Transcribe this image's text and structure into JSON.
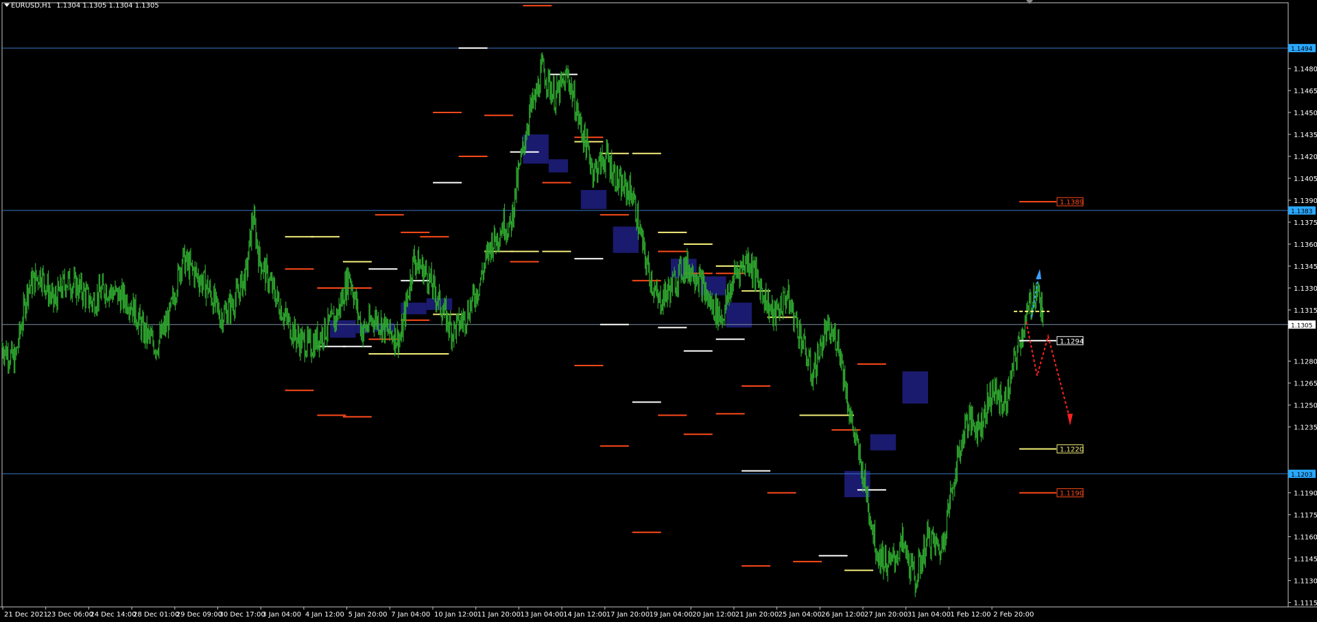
{
  "window": {
    "symbol_label": "EURUSD,H1",
    "ohlc": "1.1304 1.1305 1.1304 1.1305"
  },
  "colors": {
    "background": "#000000",
    "candles": "#2fa82f",
    "grid_line_blue": "#3c78c8",
    "current_price_line": "#7f8fa6",
    "zone_fill": "#1a1a6e",
    "level_red": "#ff4a1a",
    "level_white": "#ffffff",
    "level_yellow": "#f5f07a",
    "arrow_red": "#ff2020",
    "arrow_blue": "#3ca0ff",
    "axis_text": "#ffffff"
  },
  "chart_data": {
    "type": "candlestick",
    "symbol": "EURUSD",
    "timeframe": "H1",
    "y_range": [
      1.1112,
      1.1525
    ],
    "y_ticks": [
      "1.1480",
      "1.1465",
      "1.1450",
      "1.1435",
      "1.1420",
      "1.1405",
      "1.1390",
      "1.1375",
      "1.1360",
      "1.1345",
      "1.1330",
      "1.1315",
      "1.1280",
      "1.1265",
      "1.1250",
      "1.1235",
      "1.1190",
      "1.1175",
      "1.1160",
      "1.1145",
      "1.1130",
      "1.1115"
    ],
    "y_tick_values": [
      1.148,
      1.1465,
      1.145,
      1.1435,
      1.142,
      1.1405,
      1.139,
      1.1375,
      1.136,
      1.1345,
      1.133,
      1.1315,
      1.128,
      1.1265,
      1.125,
      1.1235,
      1.119,
      1.1175,
      1.116,
      1.1145,
      1.113,
      1.1115
    ],
    "x_labels": [
      "21 Dec 2021",
      "23 Dec 06:00",
      "24 Dec 14:00",
      "28 Dec 01:00",
      "29 Dec 09:00",
      "30 Dec 17:00",
      "3 Jan 04:00",
      "4 Jan 12:00",
      "5 Jan 20:00",
      "7 Jan 04:00",
      "10 Jan 12:00",
      "11 Jan 20:00",
      "13 Jan 04:00",
      "14 Jan 12:00",
      "17 Jan 20:00",
      "19 Jan 04:00",
      "20 Jan 12:00",
      "21 Jan 20:00",
      "25 Jan 04:00",
      "26 Jan 12:00",
      "27 Jan 20:00",
      "31 Jan 04:00",
      "1 Feb 12:00",
      "2 Feb 20:00"
    ],
    "close_path": [
      [
        0,
        1.129
      ],
      [
        0.01,
        1.128
      ],
      [
        0.02,
        1.133
      ],
      [
        0.03,
        1.134
      ],
      [
        0.04,
        1.132
      ],
      [
        0.05,
        1.1335
      ],
      [
        0.06,
        1.133
      ],
      [
        0.07,
        1.132
      ],
      [
        0.08,
        1.133
      ],
      [
        0.09,
        1.1325
      ],
      [
        0.1,
        1.132
      ],
      [
        0.11,
        1.13
      ],
      [
        0.12,
        1.129
      ],
      [
        0.13,
        1.131
      ],
      [
        0.14,
        1.135
      ],
      [
        0.15,
        1.134
      ],
      [
        0.16,
        1.133
      ],
      [
        0.17,
        1.131
      ],
      [
        0.18,
        1.132
      ],
      [
        0.19,
        1.134
      ],
      [
        0.195,
        1.138
      ],
      [
        0.2,
        1.135
      ],
      [
        0.21,
        1.133
      ],
      [
        0.22,
        1.131
      ],
      [
        0.23,
        1.1295
      ],
      [
        0.24,
        1.129
      ],
      [
        0.25,
        1.13
      ],
      [
        0.26,
        1.131
      ],
      [
        0.27,
        1.134
      ],
      [
        0.28,
        1.13
      ],
      [
        0.29,
        1.131
      ],
      [
        0.3,
        1.13
      ],
      [
        0.31,
        1.1295
      ],
      [
        0.32,
        1.135
      ],
      [
        0.33,
        1.134
      ],
      [
        0.34,
        1.132
      ],
      [
        0.35,
        1.13
      ],
      [
        0.36,
        1.131
      ],
      [
        0.37,
        1.133
      ],
      [
        0.38,
        1.136
      ],
      [
        0.385,
        1.1365
      ],
      [
        0.39,
        1.1375
      ],
      [
        0.395,
        1.137
      ],
      [
        0.4,
        1.14
      ],
      [
        0.41,
        1.145
      ],
      [
        0.415,
        1.146
      ],
      [
        0.42,
        1.148
      ],
      [
        0.43,
        1.146
      ],
      [
        0.44,
        1.1475
      ],
      [
        0.45,
        1.144
      ],
      [
        0.46,
        1.141
      ],
      [
        0.47,
        1.142
      ],
      [
        0.48,
        1.14
      ],
      [
        0.49,
        1.1395
      ],
      [
        0.5,
        1.135
      ],
      [
        0.51,
        1.132
      ],
      [
        0.52,
        1.133
      ],
      [
        0.53,
        1.1345
      ],
      [
        0.54,
        1.134
      ],
      [
        0.55,
        1.132
      ],
      [
        0.56,
        1.131
      ],
      [
        0.57,
        1.134
      ],
      [
        0.58,
        1.135
      ],
      [
        0.59,
        1.133
      ],
      [
        0.6,
        1.131
      ],
      [
        0.61,
        1.1325
      ],
      [
        0.62,
        1.13
      ],
      [
        0.63,
        1.127
      ],
      [
        0.64,
        1.13
      ],
      [
        0.65,
        1.1295
      ],
      [
        0.66,
        1.124
      ],
      [
        0.67,
        1.12
      ],
      [
        0.68,
        1.115
      ],
      [
        0.69,
        1.114
      ],
      [
        0.7,
        1.1155
      ],
      [
        0.71,
        1.113
      ],
      [
        0.72,
        1.116
      ],
      [
        0.73,
        1.115
      ],
      [
        0.74,
        1.12
      ],
      [
        0.75,
        1.124
      ],
      [
        0.76,
        1.1235
      ],
      [
        0.77,
        1.126
      ],
      [
        0.78,
        1.125
      ],
      [
        0.79,
        1.129
      ],
      [
        0.8,
        1.132
      ],
      [
        0.805,
        1.133
      ],
      [
        0.81,
        1.1305
      ]
    ],
    "horizontal_lines": [
      {
        "price": 1.1494,
        "label": "1.1494",
        "color": "blue"
      },
      {
        "price": 1.1383,
        "label": "1.1383",
        "color": "blue"
      },
      {
        "price": 1.1305,
        "label": "1.1305",
        "color": "current"
      },
      {
        "price": 1.1203,
        "label": "1.1203",
        "color": "blue"
      }
    ],
    "levels_labeled": [
      {
        "price": 1.1389,
        "label": "1.1389",
        "color": "red"
      },
      {
        "price": 1.1294,
        "label": "1.1294",
        "color": "white"
      },
      {
        "price": 1.122,
        "label": "1.1220",
        "color": "yellow"
      },
      {
        "price": 1.119,
        "label": "1.1190",
        "color": "red"
      }
    ]
  }
}
